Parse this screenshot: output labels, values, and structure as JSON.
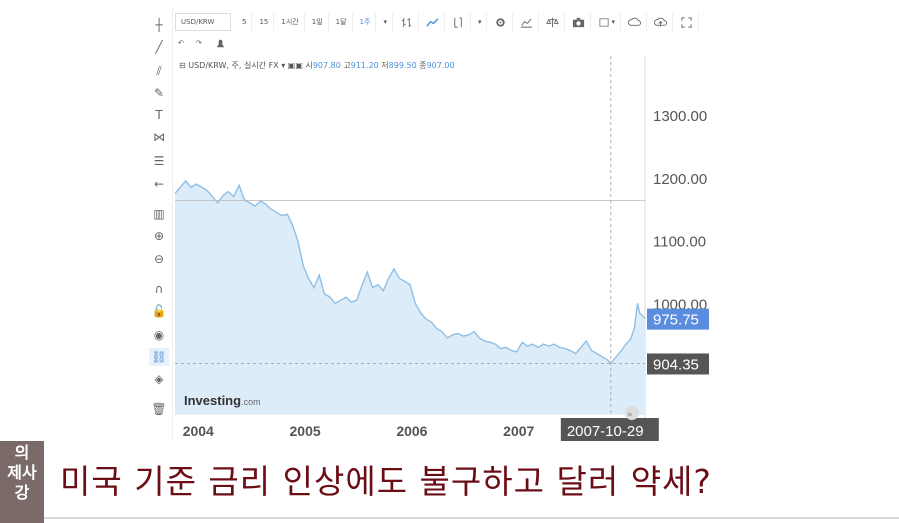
{
  "toolbar": {
    "symbol": "USD/KRW",
    "intervals": [
      "5",
      "15",
      "1시간",
      "1일",
      "1달",
      "1주"
    ],
    "active_interval": "1주"
  },
  "legend": {
    "name": "USD/KRW, 주, 실시간 FX",
    "open_label": "시",
    "open": "907.80",
    "high_label": "고",
    "high": "911.20",
    "low_label": "저",
    "low": "899.50",
    "close_label": "종",
    "close": "907.00"
  },
  "watermark": "Investing",
  "watermark_suffix": ".com",
  "caption": {
    "logo_lines": [
      "의",
      "제사",
      "강"
    ],
    "headline": "미국 기준 금리 인상에도 불구하고 달러 약세?"
  },
  "colors": {
    "line": "#8fbfe6",
    "fill": "#dcecf9",
    "last_price_bg": "#5b8ddf",
    "crosshair_price_bg": "#555555",
    "headline": "#6b0d14"
  },
  "icons": [
    "crosshair-icon",
    "trend-line-icon",
    "pitchfork-icon",
    "brush-icon",
    "text-icon",
    "pattern-icon",
    "measure-icon",
    "arrow-left-icon",
    "zoom-in-icon",
    "zoom-out-icon",
    "magnet-icon",
    "lock-icon",
    "eye-icon",
    "link-icon",
    "layers-icon",
    "trash-icon"
  ],
  "chart_data": {
    "type": "area",
    "title": "USD/KRW, 주, 실시간 FX",
    "xlabel": "",
    "ylabel": "",
    "x_range": [
      2003.75,
      2008.15
    ],
    "ylim": [
      860,
      1370
    ],
    "yticks": [
      1300,
      1200,
      1100,
      1000
    ],
    "ytick_labels": [
      "1300.00",
      "1200.00",
      "1100.00",
      "1000.00"
    ],
    "xtick_labels": [
      {
        "label": "2004",
        "x": 2004.0
      },
      {
        "label": "2005",
        "x": 2005.0
      },
      {
        "label": "2006",
        "x": 2006.0
      },
      {
        "label": "2007",
        "x": 2007.0
      }
    ],
    "last_price": 975.75,
    "last_price_label": "975.75",
    "crosshair": {
      "x": 2007.83,
      "y": 904.35,
      "y_label": "904.35",
      "x_label": "2007-10-29"
    },
    "series": [
      {
        "x": [
          2003.75,
          2003.8,
          2003.85,
          2003.9,
          2003.95,
          2004.0,
          2004.05,
          2004.1,
          2004.15,
          2004.2,
          2004.25,
          2004.3,
          2004.35,
          2004.4,
          2004.45,
          2004.5,
          2004.55,
          2004.6,
          2004.65,
          2004.7,
          2004.75,
          2004.8,
          2004.85,
          2004.9,
          2004.95,
          2005.0,
          2005.05,
          2005.1,
          2005.15,
          2005.2,
          2005.25,
          2005.3,
          2005.35,
          2005.4,
          2005.45,
          2005.5,
          2005.55,
          2005.6,
          2005.65,
          2005.7,
          2005.75,
          2005.8,
          2005.85,
          2005.9,
          2005.95,
          2006.0,
          2006.05,
          2006.1,
          2006.15,
          2006.2,
          2006.25,
          2006.3,
          2006.35,
          2006.4,
          2006.45,
          2006.5,
          2006.55,
          2006.6,
          2006.65,
          2006.7,
          2006.75,
          2006.8,
          2006.85,
          2006.9,
          2006.95,
          2007.0,
          2007.05,
          2007.1,
          2007.15,
          2007.2,
          2007.25,
          2007.3,
          2007.35,
          2007.4,
          2007.45,
          2007.5,
          2007.55,
          2007.6,
          2007.65,
          2007.7,
          2007.75,
          2007.8,
          2007.83,
          2007.88,
          2007.93,
          2007.97,
          2008.0,
          2008.02,
          2008.05,
          2008.08,
          2008.1,
          2008.15
        ],
        "y": [
          1175,
          1185,
          1195,
          1185,
          1190,
          1185,
          1180,
          1170,
          1160,
          1172,
          1178,
          1170,
          1188,
          1165,
          1160,
          1155,
          1163,
          1158,
          1150,
          1145,
          1140,
          1142,
          1125,
          1100,
          1060,
          1040,
          1025,
          1045,
          1015,
          1010,
          1000,
          1005,
          1010,
          1002,
          1005,
          1028,
          1050,
          1025,
          1030,
          1020,
          1040,
          1055,
          1040,
          1035,
          1030,
          1000,
          985,
          975,
          970,
          960,
          955,
          945,
          950,
          952,
          948,
          950,
          955,
          945,
          940,
          938,
          935,
          928,
          930,
          925,
          923,
          938,
          932,
          935,
          930,
          935,
          932,
          935,
          930,
          928,
          925,
          920,
          930,
          940,
          925,
          920,
          915,
          910,
          905,
          915,
          925,
          935,
          940,
          945,
          960,
          1000,
          985,
          976
        ]
      }
    ]
  }
}
